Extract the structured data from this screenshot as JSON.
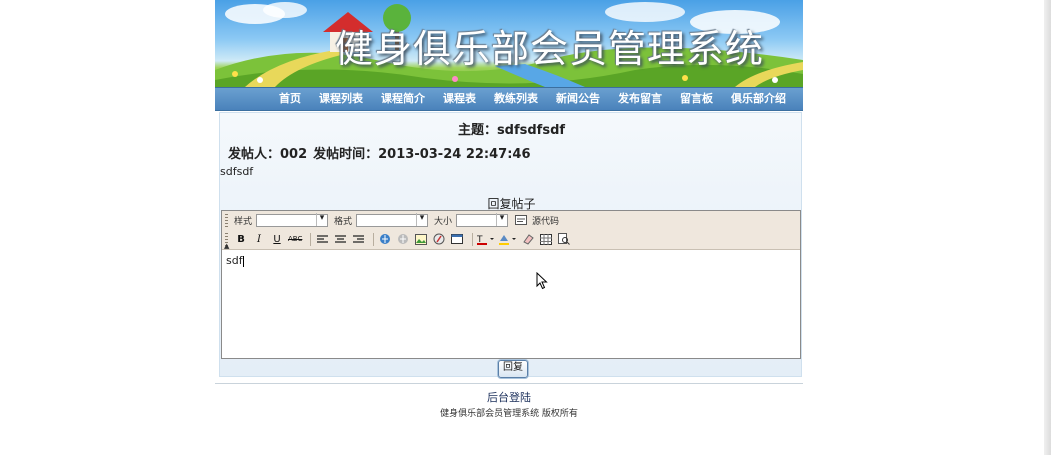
{
  "header": {
    "title": "健身俱乐部会员管理系统"
  },
  "nav": {
    "items": [
      "首页",
      "课程列表",
      "课程简介",
      "课程表",
      "教练列表",
      "新闻公告",
      "发布留言",
      "留言板",
      "俱乐部介绍"
    ]
  },
  "post": {
    "title": "主题：sdfsdfsdf",
    "poster": "发帖人：002",
    "time": "发帖时间：2013-03-24 22:47:46",
    "body": "sdfsdf"
  },
  "reply": {
    "heading": "回复帖子",
    "button_label": "回复",
    "content": "sdf"
  },
  "editor": {
    "style_label": "样式",
    "format_label": "格式",
    "size_label": "大小",
    "source_label": "源代码"
  },
  "footer": {
    "admin_link": "后台登陆",
    "copyright": "健身俱乐部会员管理系统 版权所有"
  },
  "colors": {
    "nav_bg": "#5a8fc4",
    "panel_bg": "#eef4fa",
    "toolbar_bg": "#efe7dd"
  }
}
